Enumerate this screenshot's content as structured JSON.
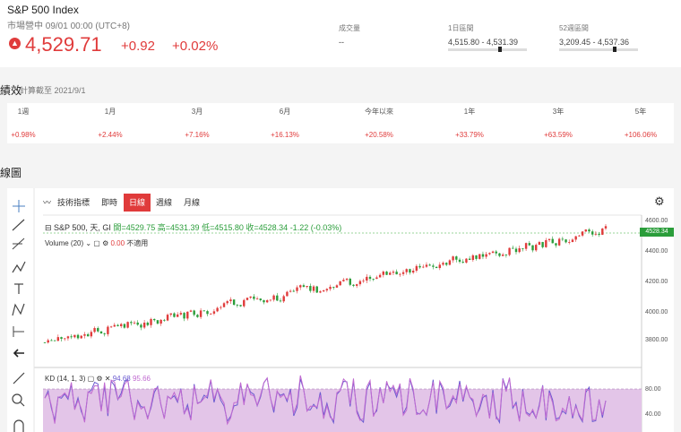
{
  "header": {
    "title": "S&P 500 Index",
    "subtitle": "市場營中 09/01 00:00 (UTC+8)",
    "price": "4,529.71",
    "change": "+0.92",
    "change_pct": "+0.02%",
    "volume_label": "成交量",
    "volume_value": "--",
    "day_range_label": "1日區間",
    "day_range_value": "4,515.80 - 4,531.39",
    "wk52_label": "52週區間",
    "wk52_value": "3,209.45 - 4,537.36",
    "accent": "#e03b3b"
  },
  "performance": {
    "title": "績效",
    "note": "計算截至 2021/9/1",
    "periods": [
      {
        "label": "1週",
        "value": "+0.98%"
      },
      {
        "label": "1月",
        "value": "+2.44%"
      },
      {
        "label": "3月",
        "value": "+7.16%"
      },
      {
        "label": "6月",
        "value": "+16.13%"
      },
      {
        "label": "今年以來",
        "value": "+20.58%"
      },
      {
        "label": "1年",
        "value": "+33.79%"
      },
      {
        "label": "3年",
        "value": "+63.59%"
      },
      {
        "label": "5年",
        "value": "+106.06%"
      }
    ]
  },
  "chart_section": {
    "title": "線圖",
    "toolbar": {
      "indicators": "技術指標",
      "realtime": "即時",
      "daily": "日線",
      "weekly": "週線",
      "monthly": "月線"
    },
    "legend": {
      "name": "S&P 500, 天, GI",
      "open": "開=4529.75",
      "high": "高=4531.39",
      "low": "低=4515.80",
      "close": "收=4528.34",
      "change": "-1.22 (-0.03%)"
    },
    "volume": {
      "label": "Volume (20)",
      "value": "0.00",
      "na": "不適用"
    },
    "kd": {
      "label": "KD (14, 1, 3)",
      "k": "94.68",
      "d": "95.66"
    },
    "last_price_tag": "4528.34",
    "price_axis": [
      "4600.00",
      "4400.00",
      "4200.00",
      "4000.00",
      "3800.00"
    ],
    "kd_axis": [
      "80.00",
      "40.00"
    ],
    "up_color": "#e03b3b",
    "down_color": "#2a9d3a"
  }
}
